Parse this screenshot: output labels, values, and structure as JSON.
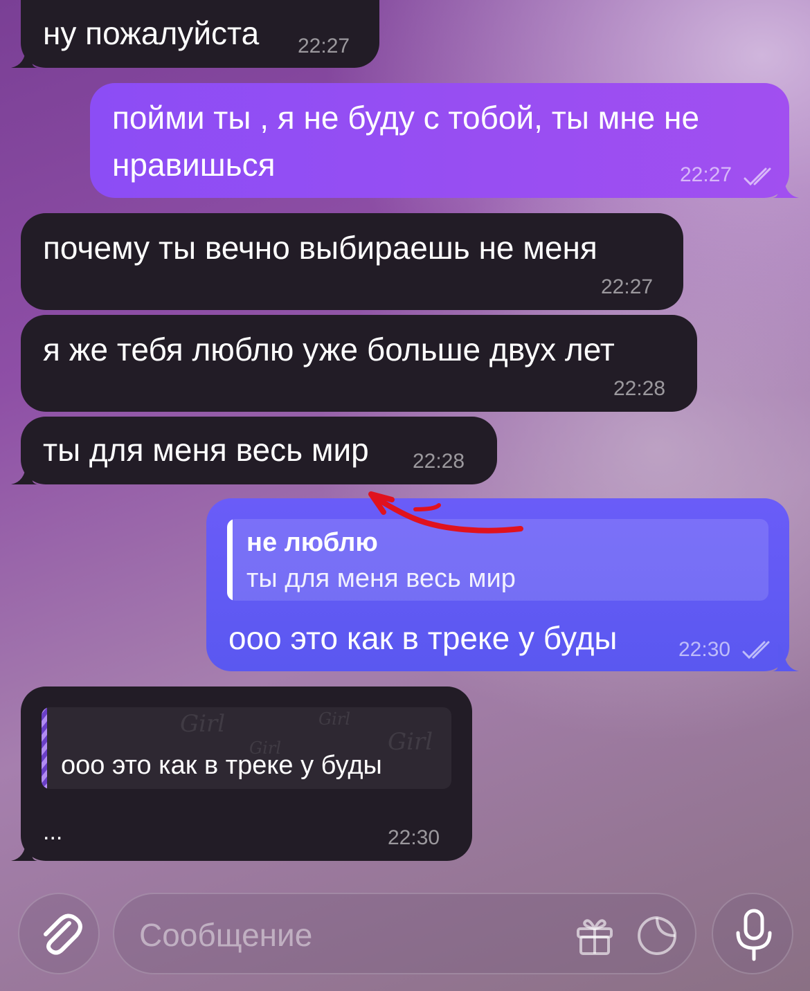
{
  "messages": [
    {
      "text": "ну пожалуйста",
      "time": "22:27"
    },
    {
      "text_line1": "пойми ты , я не буду с тобой, ты мне не",
      "text_line2": "нравишься",
      "time": "22:27"
    },
    {
      "text": "почему ты вечно выбираешь не меня",
      "time": "22:27"
    },
    {
      "text": "я же тебя люблю уже больше двух лет",
      "time": "22:28"
    },
    {
      "text": "ты для меня весь мир",
      "time": "22:28"
    },
    {
      "quote_title": "не люблю",
      "quote_text": "ты для меня весь мир",
      "text": "ооо это как в треке у буды",
      "time": "22:30"
    },
    {
      "quote_text": "ооо это как в треке у буды",
      "quote_watermark": "Girl",
      "text": "...",
      "time": "22:30"
    }
  ],
  "composer": {
    "placeholder": "Сообщение",
    "attach_icon": "paperclip-icon",
    "gift_icon": "gift-icon",
    "sticker_icon": "sticker-icon",
    "mic_icon": "microphone-icon"
  },
  "colors": {
    "incoming_bubble": "#221c26",
    "outgoing_bubble": "#9a4ef2",
    "outgoing_reply_bubble": "#625af4",
    "annotation_arrow": "#e0121e"
  }
}
